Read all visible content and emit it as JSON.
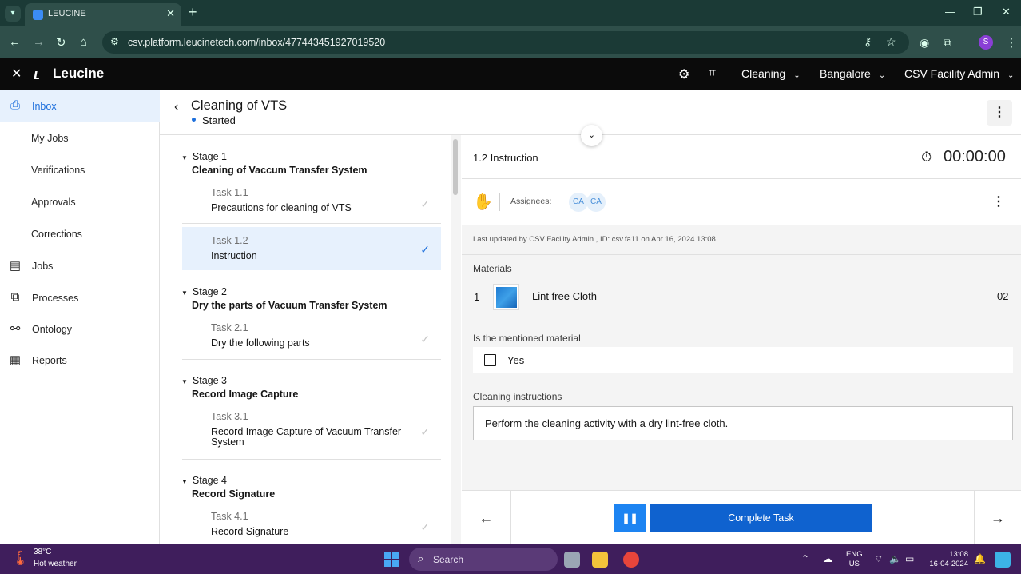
{
  "browser": {
    "tab_title": "LEUCINE",
    "url": "csv.platform.leucinetech.com/inbox/477443451927019520",
    "profile_initial": "S"
  },
  "app": {
    "brand": "Leucine",
    "use_case": "Cleaning",
    "facility": "Bangalore",
    "user": "CSV Facility Admin"
  },
  "nav": {
    "items": [
      {
        "label": "Inbox",
        "icon": "inbox-icon"
      },
      {
        "label": "My Jobs"
      },
      {
        "label": "Verifications"
      },
      {
        "label": "Approvals"
      },
      {
        "label": "Corrections"
      },
      {
        "label": "Jobs",
        "icon": "clipboard-icon"
      },
      {
        "label": "Processes",
        "icon": "flow-icon"
      },
      {
        "label": "Ontology",
        "icon": "hierarchy-icon"
      },
      {
        "label": "Reports",
        "icon": "report-icon"
      }
    ]
  },
  "job": {
    "title": "Cleaning of VTS",
    "status": "Started"
  },
  "stages": [
    {
      "label": "Stage 1",
      "name": "Cleaning of Vaccum Transfer System",
      "tasks": [
        {
          "num": "Task 1.1",
          "name": "Precautions for cleaning of VTS"
        },
        {
          "num": "Task 1.2",
          "name": "Instruction"
        }
      ]
    },
    {
      "label": "Stage 2",
      "name": "Dry the parts of Vacuum Transfer System",
      "tasks": [
        {
          "num": "Task 2.1",
          "name": "Dry the following parts"
        }
      ]
    },
    {
      "label": "Stage 3",
      "name": "Record Image Capture",
      "tasks": [
        {
          "num": "Task 3.1",
          "name": "Record Image Capture of Vacuum Transfer System"
        }
      ]
    },
    {
      "label": "Stage 4",
      "name": "Record Signature",
      "tasks": [
        {
          "num": "Task 4.1",
          "name": "Record Signature"
        }
      ]
    }
  ],
  "step": {
    "title": "1.2 Instruction",
    "timer": "00:00:00",
    "assignees_label": "Assignees:",
    "assignees": [
      "CA",
      "CA"
    ],
    "last_updated": "Last updated by CSV Facility Admin , ID: csv.fa11 on Apr 16, 2024 13:08",
    "materials_title": "Materials",
    "material": {
      "index": "1",
      "name": "Lint free Cloth",
      "qty": "02"
    },
    "question_label": "Is the mentioned material",
    "option_yes": "Yes",
    "instructions_label": "Cleaning instructions",
    "instructions_text": "Perform the cleaning activity with a dry lint-free cloth."
  },
  "footer": {
    "complete_label": "Complete Task"
  },
  "taskbar": {
    "temp": "38°C",
    "weather": "Hot weather",
    "search": "Search",
    "lang1": "ENG",
    "lang2": "US",
    "time": "13:08",
    "date": "16-04-2024"
  }
}
